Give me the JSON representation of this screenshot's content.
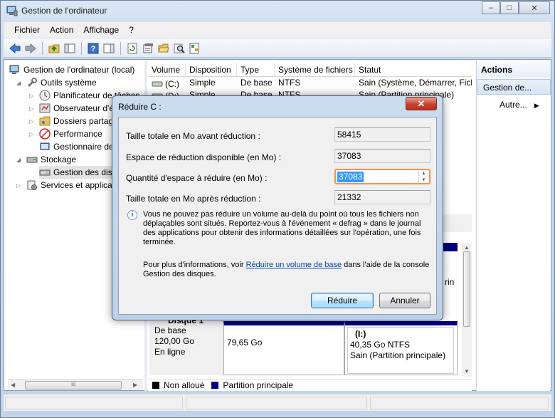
{
  "window": {
    "title": "Gestion de l'ordinateur",
    "minimize": "–",
    "maximize": "□",
    "close": "✕"
  },
  "menu": [
    "Fichier",
    "Action",
    "Affichage",
    "?"
  ],
  "toolbar_icons": [
    "back-arrow-icon",
    "forward-arrow-icon",
    "up-folder-icon",
    "show-tree-icon",
    "help-icon",
    "show-action-pane-icon",
    "refresh-icon",
    "properties-icon",
    "open-folder-icon",
    "search-icon",
    "export-icon"
  ],
  "tree": {
    "root": "Gestion de l'ordinateur (local)",
    "system_tools": "Outils système",
    "scheduler": "Planificateur de tâches",
    "event_viewer": "Observateur d'év",
    "shared_folders": "Dossiers partag",
    "performance": "Performance",
    "device_manager": "Gestionnaire de",
    "storage": "Stockage",
    "disk_management": "Gestion des dis",
    "services": "Services et applicat"
  },
  "volumes": {
    "headers": [
      "Volume",
      "Disposition",
      "Type",
      "Système de fichiers",
      "Statut"
    ],
    "rows": [
      {
        "volume": "(C:)",
        "layout": "Simple",
        "type": "De base",
        "fs": "NTFS",
        "status": "Sain (Système, Démarrer, Fichi"
      },
      {
        "volume": "(D:)",
        "layout": "Simple",
        "type": "De base",
        "fs": "NTFS",
        "status": "Sain (Partition principale)"
      }
    ]
  },
  "disk": {
    "name": "Disque 1",
    "type": "De base",
    "size": "120,00 Go",
    "state": "En ligne",
    "part1_size": "79,65 Go",
    "part2_label": "(I:)",
    "part2_size": "40,35 Go NTFS",
    "part2_status": "Sain (Partition principale)",
    "cut_text": "rin"
  },
  "legend": {
    "unallocated": "Non alloué",
    "primary": "Partition principale",
    "unallocated_color": "#000000",
    "primary_color": "#000080"
  },
  "actions": {
    "header": "Actions",
    "selected": "Gestion de...",
    "more": "Autre..."
  },
  "dialog": {
    "title": "Réduire C :",
    "total_before_label": "Taille totale en Mo avant réduction :",
    "total_before_value": "58415",
    "available_label": "Espace de réduction disponible (en Mo) :",
    "available_value": "37083",
    "shrink_label": "Quantité d'espace à réduire (en Mo) :",
    "shrink_value": "37083",
    "total_after_label": "Taille totale en Mo après réduction :",
    "total_after_value": "21332",
    "info_text": "Vous ne pouvez pas réduire un volume au-delà du point où tous les fichiers non déplaçables sont situés. Reportez-vous à l'événement « defrag » dans le journal des applications pour obtenir des informations détaillées sur l'opération, une fois terminée.",
    "more_prefix": "Pour plus d'informations, voir ",
    "more_link": "Réduire un volume de base",
    "more_suffix": " dans l'aide de la console Gestion des disques.",
    "shrink_button": "Réduire",
    "cancel_button": "Annuler",
    "close": "✕"
  }
}
